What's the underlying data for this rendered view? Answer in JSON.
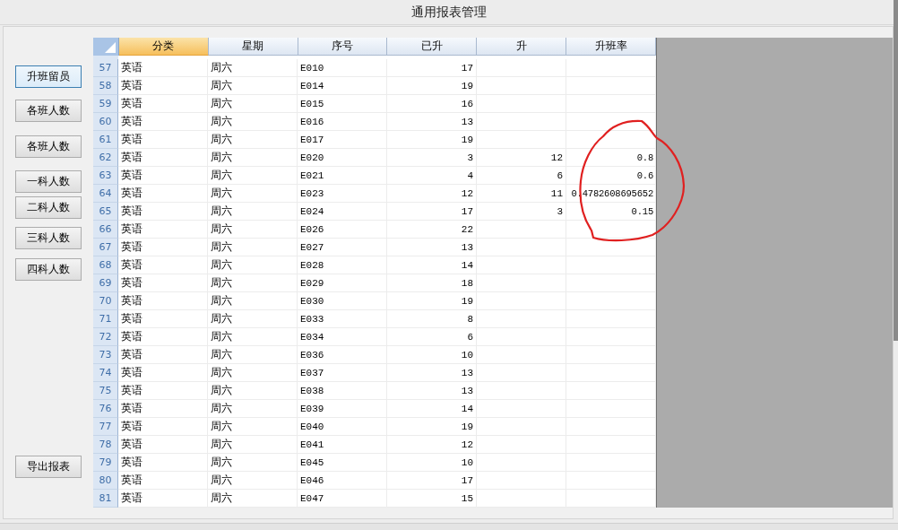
{
  "window": {
    "title": "通用报表管理"
  },
  "buttons": [
    {
      "label": "升班留员",
      "focused": true
    },
    {
      "label": "各班人数",
      "focused": false
    },
    {
      "label": "各班人数",
      "focused": false
    },
    {
      "label": "一科人数",
      "focused": false
    },
    {
      "label": "二科人数",
      "focused": false
    },
    {
      "label": "三科人数",
      "focused": false
    },
    {
      "label": "四科人数",
      "focused": false
    },
    {
      "label": "导出报表",
      "focused": false
    }
  ],
  "table": {
    "columns": [
      {
        "label": "分类",
        "selected": true
      },
      {
        "label": "星期",
        "selected": false
      },
      {
        "label": "序号",
        "selected": false
      },
      {
        "label": "已升",
        "selected": false
      },
      {
        "label": "升",
        "selected": false
      },
      {
        "label": "升班率",
        "selected": false
      }
    ],
    "rows": [
      {
        "row": "57",
        "category": "英语",
        "day": "周六",
        "code": "E010",
        "promoted": "17"
      },
      {
        "row": "58",
        "category": "英语",
        "day": "周六",
        "code": "E014",
        "promoted": "19"
      },
      {
        "row": "59",
        "category": "英语",
        "day": "周六",
        "code": "E015",
        "promoted": "16"
      },
      {
        "row": "60",
        "category": "英语",
        "day": "周六",
        "code": "E016",
        "promoted": "13"
      },
      {
        "row": "61",
        "category": "英语",
        "day": "周六",
        "code": "E017",
        "promoted": "19"
      },
      {
        "row": "62",
        "category": "英语",
        "day": "周六",
        "code": "E020",
        "promoted": "3",
        "rise": "12",
        "rate": "0.8"
      },
      {
        "row": "63",
        "category": "英语",
        "day": "周六",
        "code": "E021",
        "promoted": "4",
        "rise": "6",
        "rate": "0.6"
      },
      {
        "row": "64",
        "category": "英语",
        "day": "周六",
        "code": "E023",
        "promoted": "12",
        "rise": "11",
        "rate": "0.4782608695652"
      },
      {
        "row": "65",
        "category": "英语",
        "day": "周六",
        "code": "E024",
        "promoted": "17",
        "rise": "3",
        "rate": "0.15"
      },
      {
        "row": "66",
        "category": "英语",
        "day": "周六",
        "code": "E026",
        "promoted": "22"
      },
      {
        "row": "67",
        "category": "英语",
        "day": "周六",
        "code": "E027",
        "promoted": "13"
      },
      {
        "row": "68",
        "category": "英语",
        "day": "周六",
        "code": "E028",
        "promoted": "14"
      },
      {
        "row": "69",
        "category": "英语",
        "day": "周六",
        "code": "E029",
        "promoted": "18"
      },
      {
        "row": "70",
        "category": "英语",
        "day": "周六",
        "code": "E030",
        "promoted": "19"
      },
      {
        "row": "71",
        "category": "英语",
        "day": "周六",
        "code": "E033",
        "promoted": "8"
      },
      {
        "row": "72",
        "category": "英语",
        "day": "周六",
        "code": "E034",
        "promoted": "6"
      },
      {
        "row": "73",
        "category": "英语",
        "day": "周六",
        "code": "E036",
        "promoted": "10"
      },
      {
        "row": "74",
        "category": "英语",
        "day": "周六",
        "code": "E037",
        "promoted": "13"
      },
      {
        "row": "75",
        "category": "英语",
        "day": "周六",
        "code": "E038",
        "promoted": "13"
      },
      {
        "row": "76",
        "category": "英语",
        "day": "周六",
        "code": "E039",
        "promoted": "14"
      },
      {
        "row": "77",
        "category": "英语",
        "day": "周六",
        "code": "E040",
        "promoted": "19"
      },
      {
        "row": "78",
        "category": "英语",
        "day": "周六",
        "code": "E041",
        "promoted": "12"
      },
      {
        "row": "79",
        "category": "英语",
        "day": "周六",
        "code": "E045",
        "promoted": "10"
      },
      {
        "row": "80",
        "category": "英语",
        "day": "周六",
        "code": "E046",
        "promoted": "17"
      },
      {
        "row": "81",
        "category": "英语",
        "day": "周六",
        "code": "E047",
        "promoted": "15"
      }
    ]
  }
}
